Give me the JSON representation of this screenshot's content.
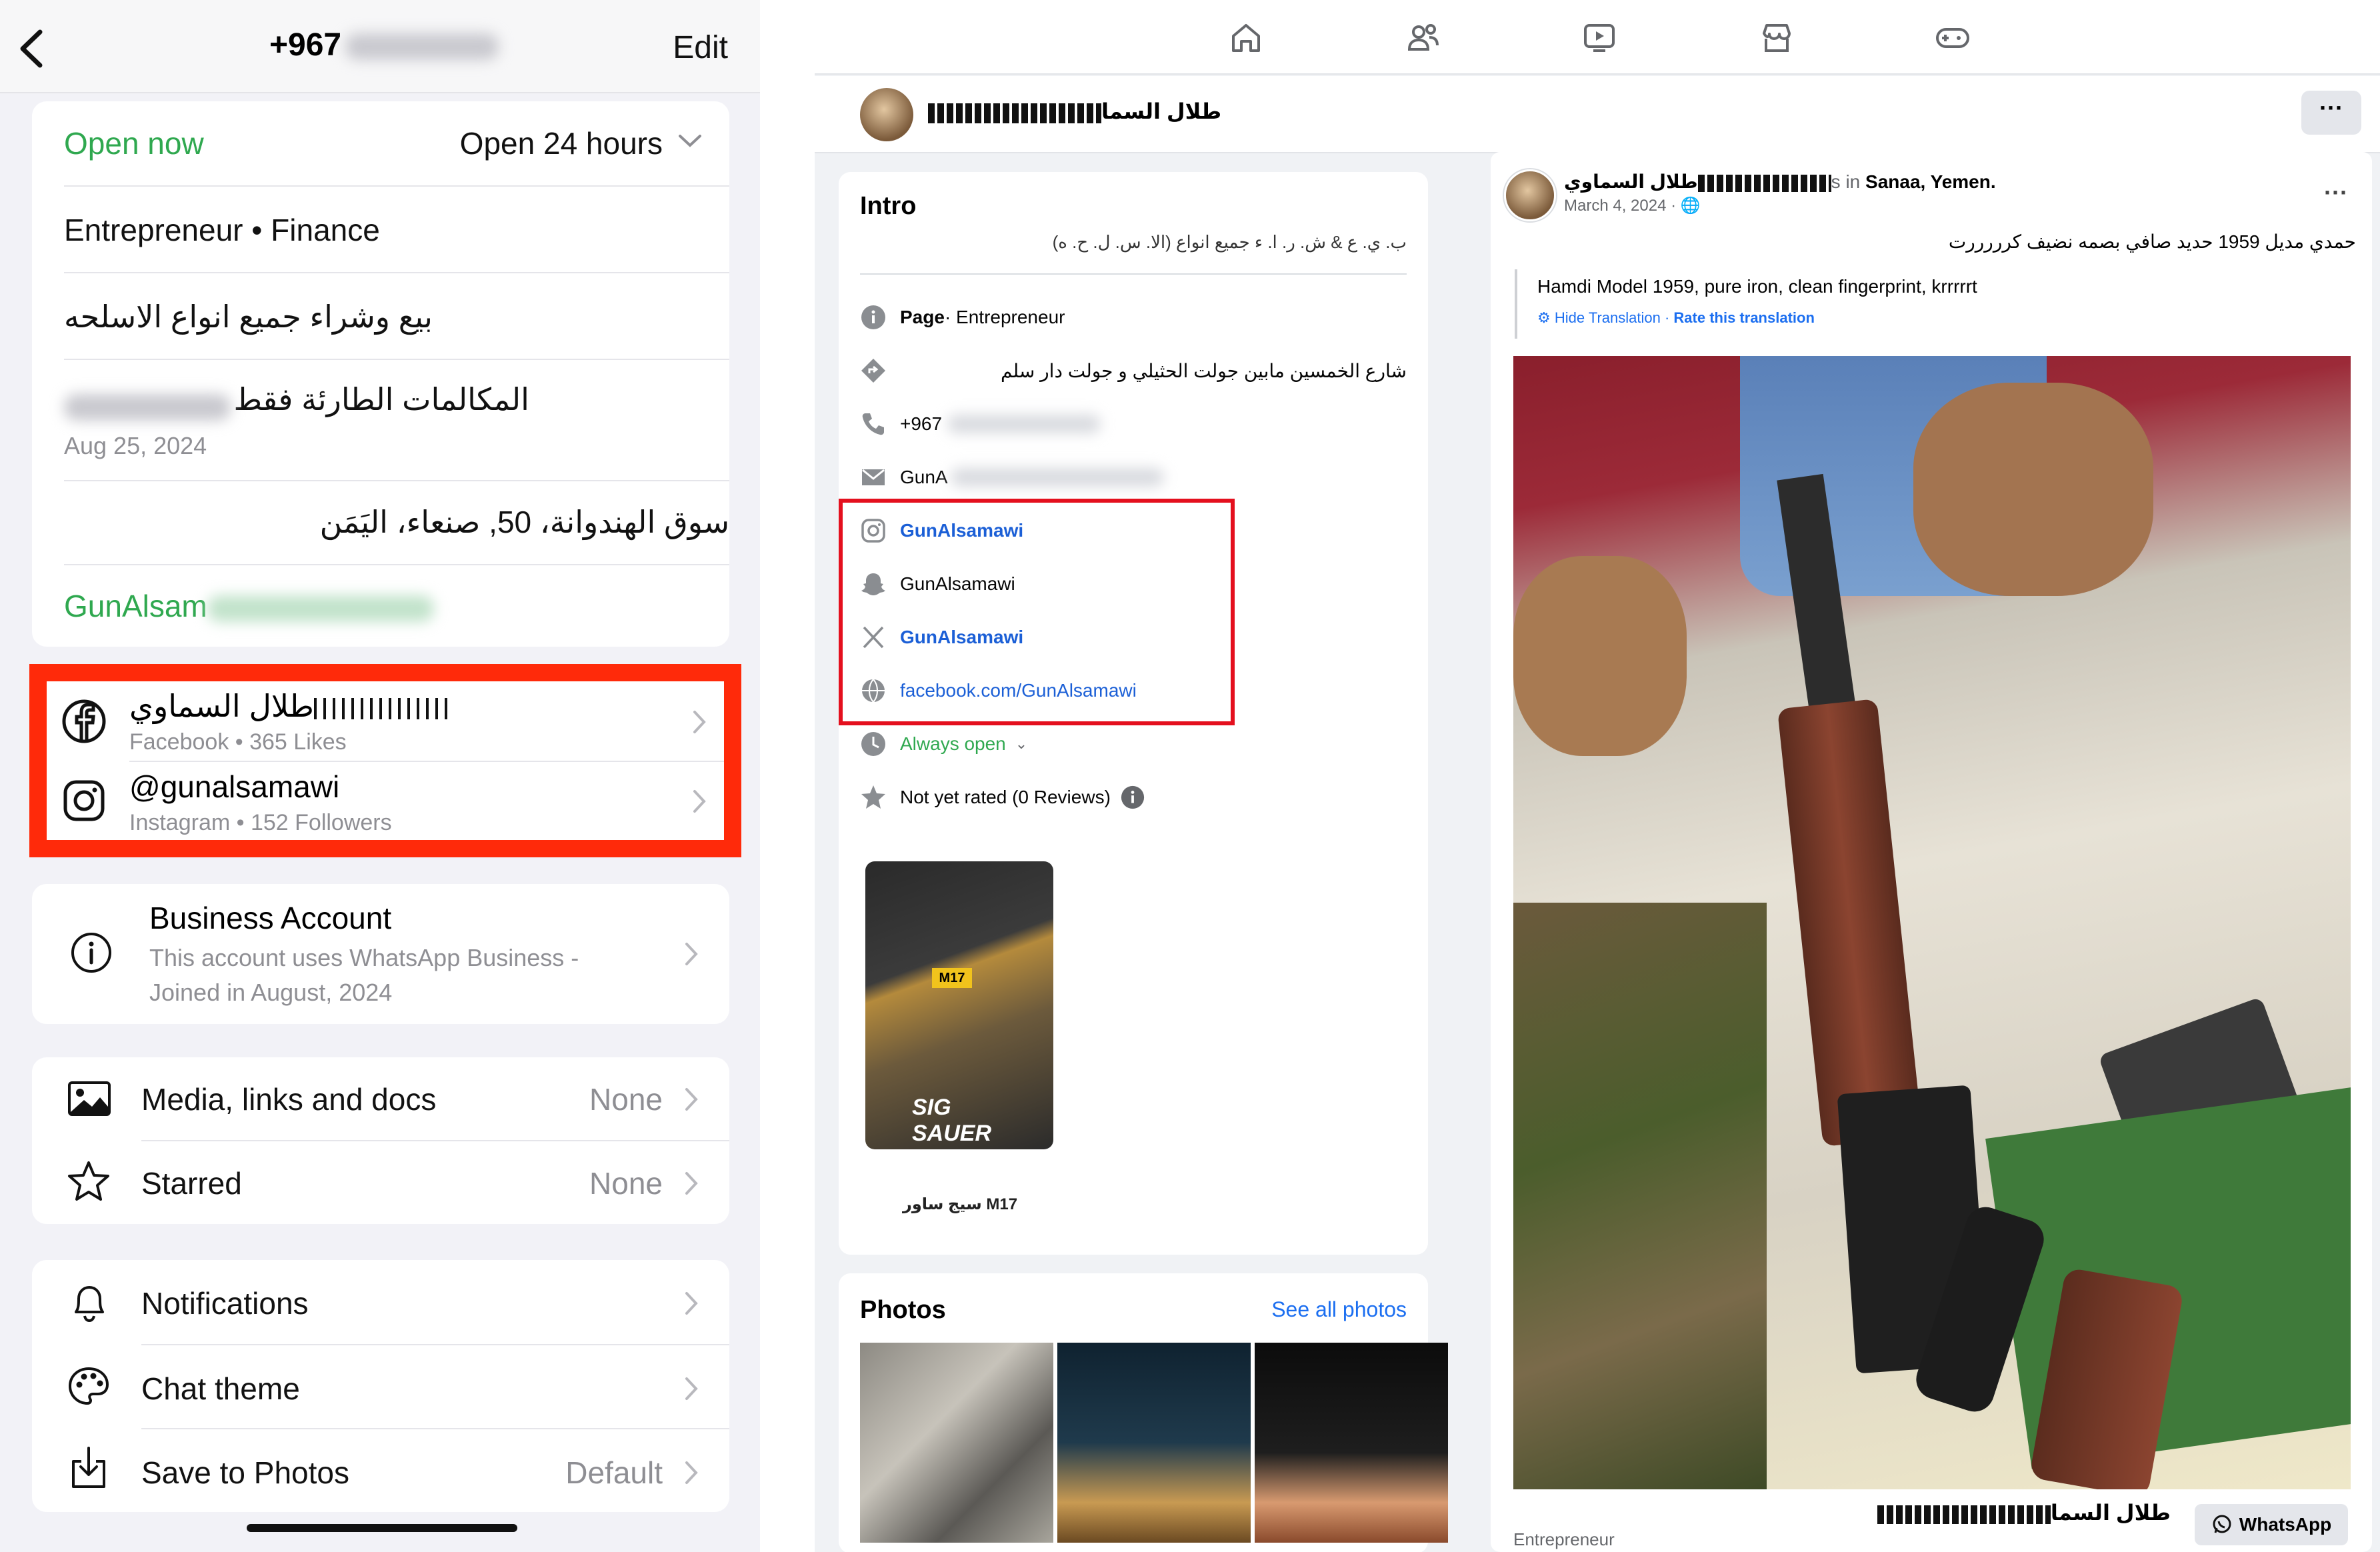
{
  "whatsapp": {
    "header": {
      "title_prefix": "+967",
      "edit_label": "Edit"
    },
    "hours": {
      "status": "Open now",
      "schedule": "Open 24 hours"
    },
    "category": "Entrepreneur • Finance",
    "description": "بيع وشراء جميع انواع الاسلحه",
    "note": {
      "text": "المكالمات الطارئة فقط",
      "date": "Aug 25, 2024"
    },
    "address": "سوق الهندوانة، 50, صنعاء، اليَمَن",
    "email_prefix": "GunAlsam",
    "linked_accounts": [
      {
        "name": "طلال السماوي",
        "sub": "Facebook • 365 Likes",
        "icon": "facebook-icon"
      },
      {
        "name": "@gunalsamawi",
        "sub": "Instagram • 152 Followers",
        "icon": "instagram-icon"
      }
    ],
    "business": {
      "title": "Business Account",
      "line1": "This account uses WhatsApp Business -",
      "line2": "Joined in August, 2024"
    },
    "media": [
      {
        "label": "Media, links and docs",
        "value": "None",
        "icon": "image-icon"
      },
      {
        "label": "Starred",
        "value": "None",
        "icon": "star-icon"
      }
    ],
    "settings": [
      {
        "label": "Notifications",
        "value": "",
        "icon": "bell-icon"
      },
      {
        "label": "Chat theme",
        "value": "",
        "icon": "palette-icon"
      },
      {
        "label": "Save to Photos",
        "value": "Default",
        "icon": "download-icon"
      }
    ]
  },
  "facebook": {
    "page_name": "طلال السما",
    "more_label": "···",
    "intro": {
      "title": "Intro",
      "bio": "ب. ي. ع & ش. ر. ا. ء جميع انواع (الا. س. ل. ح. ه)",
      "page_label": "Page",
      "page_category": " · Entrepreneur",
      "address": "شارع الخمسين مابين جولت الحثيلي و جولت دار سلم",
      "phone": "+967",
      "email": "GunA",
      "instagram": "GunAlsamawi",
      "snapchat": "GunAlsamawi",
      "x": "GunAlsamawi",
      "facebook": "facebook.com/GunAlsamawi",
      "hours": "Always open",
      "rating": "Not yet rated (0 Reviews)",
      "thumb_label": "سيج ساور M17"
    },
    "photos": {
      "title": "Photos",
      "see_all": "See all photos"
    },
    "post": {
      "author": "طلال السماوي",
      "location_sep": "s in ",
      "location": "Sanaa, Yemen",
      "date": "March 4, 2024 · ",
      "more": "···",
      "text": "حمدي مديل 1959 حديد صافي بصمه نضيف كرررررت",
      "translation": "Hamdi Model 1959, pure iron, clean fingerprint, krrrrrt",
      "hide_translation": "Hide Translation",
      "rate_translation": "Rate this translation",
      "footer_name": "طلال السما",
      "footer_sub": "Entrepreneur",
      "whatsapp": "WhatsApp"
    }
  }
}
